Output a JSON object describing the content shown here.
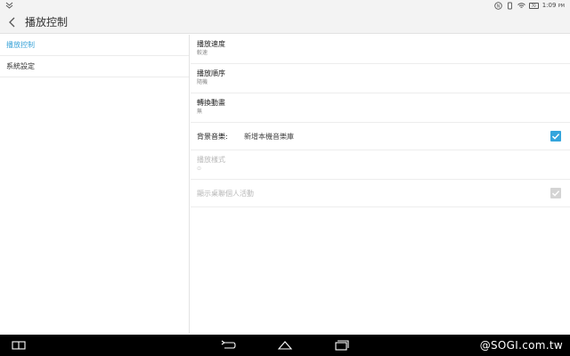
{
  "status_bar": {
    "time": "1:09",
    "time_suffix": "PM",
    "battery_level": "70",
    "icons": [
      "carrier-icon",
      "nfc-icon",
      "vibrate-icon",
      "wifi-icon",
      "battery-icon"
    ]
  },
  "toolbar": {
    "title": "播放控制",
    "back_icon": "chevron-left-icon"
  },
  "sidebar": {
    "items": [
      {
        "label": "播放控制",
        "active": true
      },
      {
        "label": "系統設定",
        "active": false
      }
    ]
  },
  "settings": {
    "speed": {
      "title": "播放速度",
      "summary": "較速"
    },
    "order": {
      "title": "播放順序",
      "summary": "隨機"
    },
    "transition": {
      "title": "轉換動畫",
      "summary": "無"
    },
    "bg_music": {
      "label": "背景音樂:",
      "value": "新增本機音樂庫",
      "checked": true
    },
    "mode": {
      "title": "播放樣式",
      "summary": "⊙",
      "enabled": false
    },
    "show_friends": {
      "title": "顯示桌聯個人活動",
      "checked": true,
      "enabled": false
    }
  },
  "navigation_bar": {
    "buttons": [
      "recent-split-icon",
      "back-icon",
      "home-icon",
      "recent-apps-icon"
    ],
    "watermark": "@SOGI.com.tw"
  },
  "colors": {
    "accent": "#34a5dc",
    "active_text": "#3aa3d8",
    "toolbar_bg": "#f3f3f3",
    "navbar_bg": "#000000"
  }
}
